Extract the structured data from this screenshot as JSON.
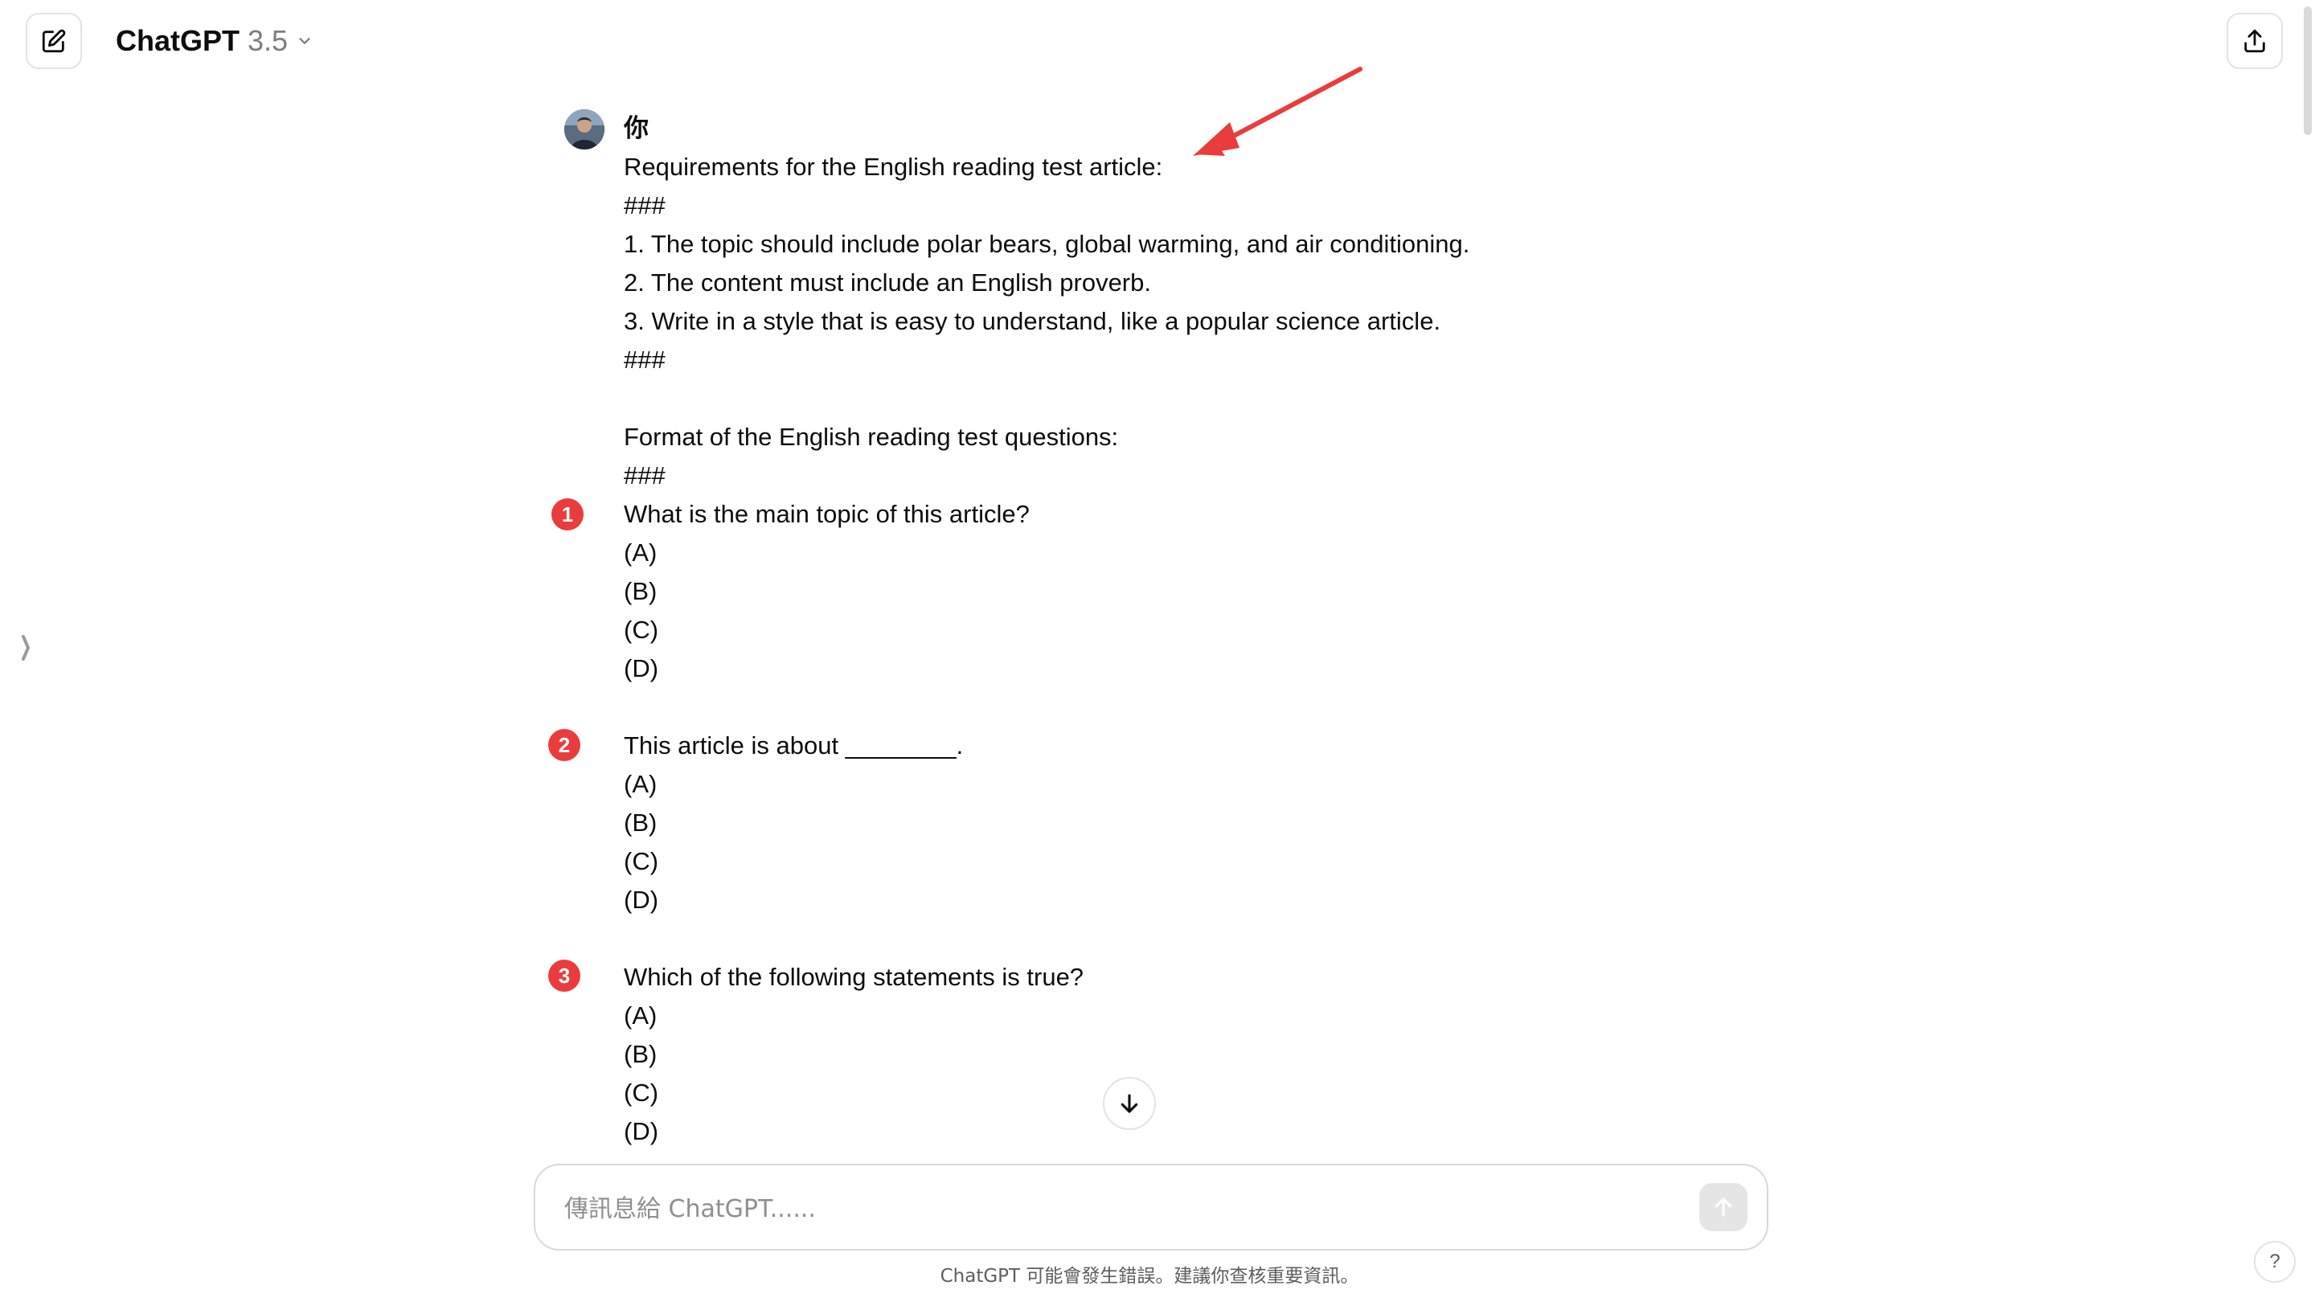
{
  "header": {
    "model_name": "ChatGPT",
    "model_version": "3.5"
  },
  "message": {
    "author": "你",
    "lines": [
      "Requirements for the English reading test article:",
      "###",
      "1. The topic should include polar bears, global warming, and air conditioning.",
      "2. The content must include an English proverb.",
      "3. Write in a style that is easy to understand, like a popular science article.",
      "###",
      "",
      "Format of the English reading test questions:",
      "###",
      "What is the main topic of this article?",
      "(A)",
      "(B)",
      "(C)",
      "(D)",
      "",
      "This article is about ________.",
      "(A)",
      "(B)",
      "(C)",
      "(D)",
      "",
      "Which of the following statements is true?",
      "(A)",
      "(B)",
      "(C)",
      "(D)"
    ]
  },
  "markers": [
    "1",
    "2",
    "3"
  ],
  "composer": {
    "placeholder": "傳訊息給 ChatGPT......"
  },
  "disclaimer": "ChatGPT 可能會發生錯誤。建議你查核重要資訊。",
  "help_label": "?",
  "colors": {
    "marker": "#ea3c3c",
    "annotation_arrow": "#ea3c3c"
  }
}
